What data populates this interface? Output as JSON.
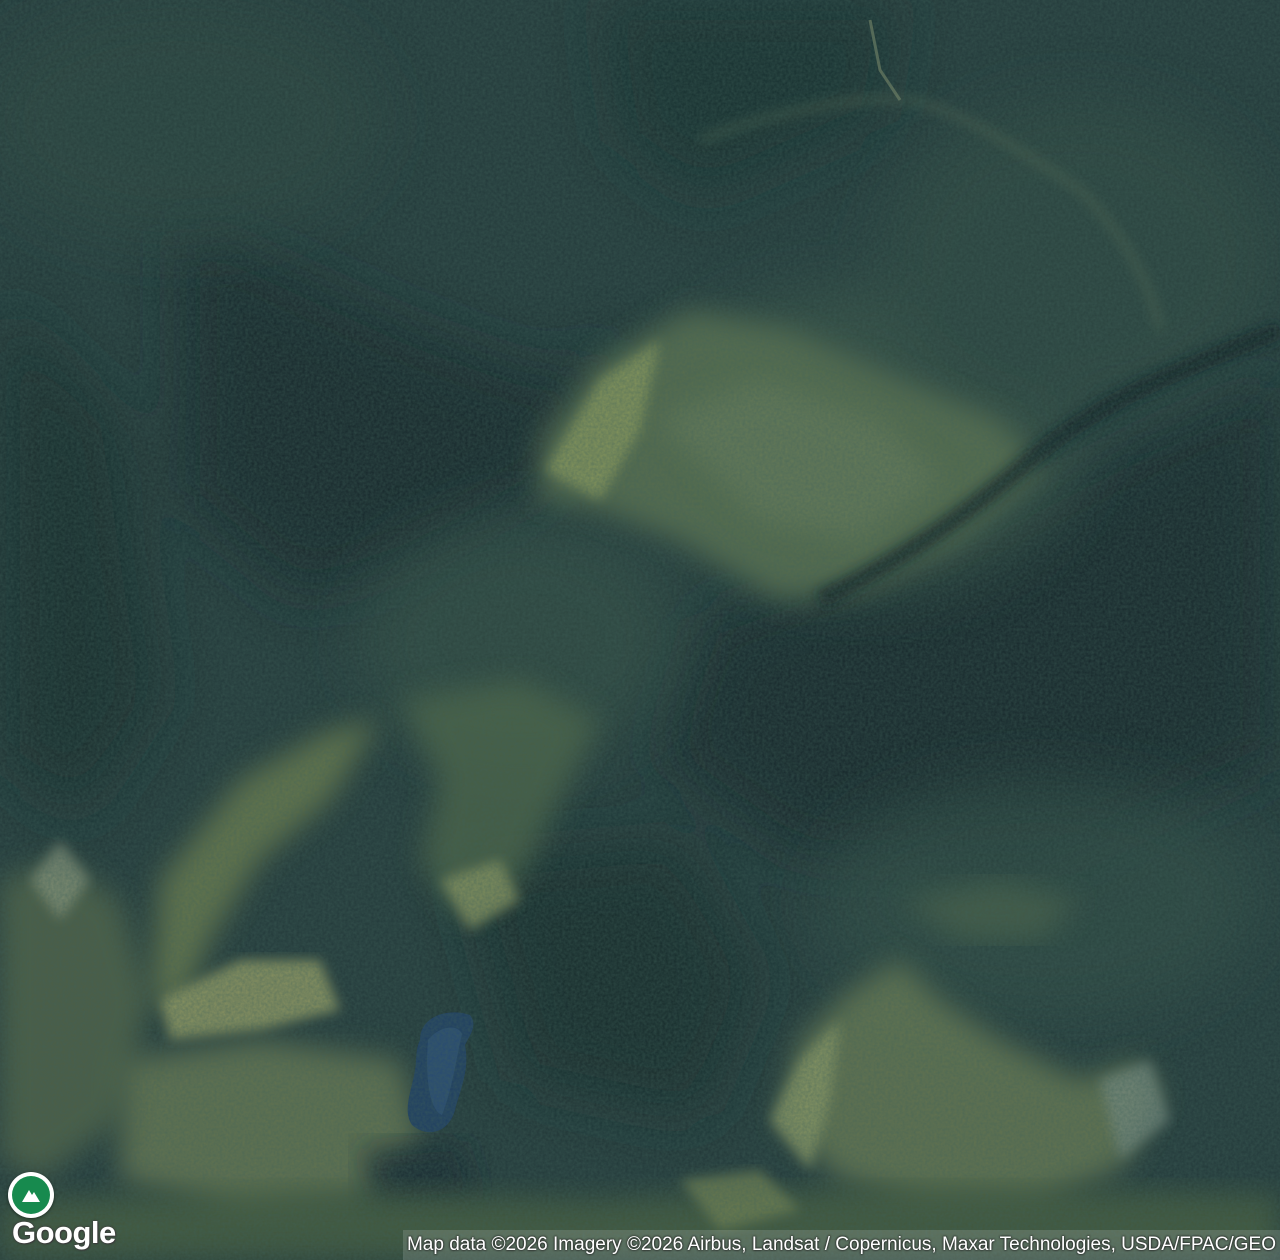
{
  "map": {
    "type": "satellite",
    "features": [
      "forested-ridges",
      "alpine-meadows",
      "mountain-lake"
    ]
  },
  "logo": {
    "text": "Google"
  },
  "pin": {
    "icon": "mountain-icon",
    "color": "#178a4e"
  },
  "attribution": {
    "text": "Map data ©2026 Imagery ©2026 Airbus, Landsat / Copernicus, Maxar Technologies, USDA/FPAC/GEO"
  }
}
